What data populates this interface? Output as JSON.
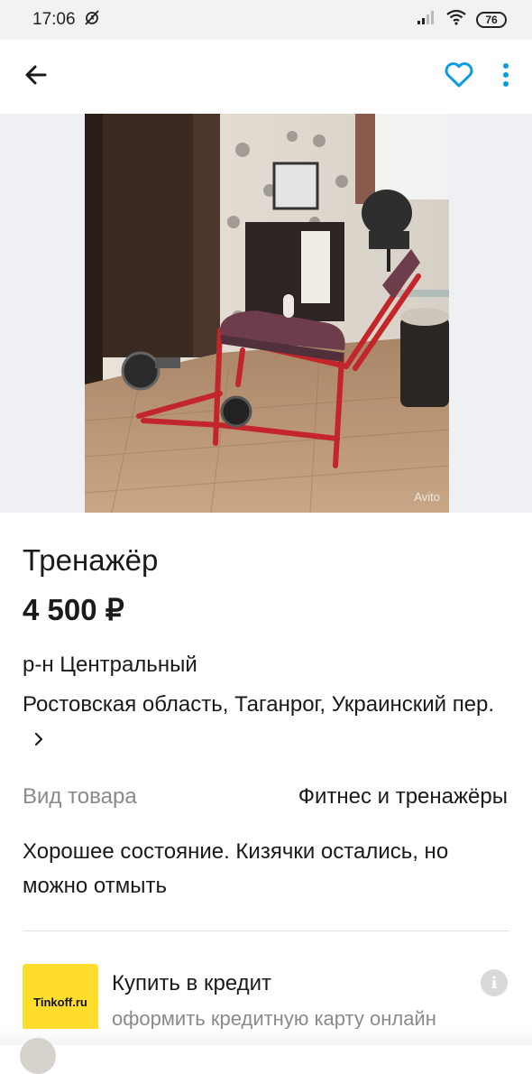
{
  "status_bar": {
    "time": "17:06",
    "battery": "76",
    "icons": [
      "muted-alarm-icon",
      "signal-icon",
      "wifi-icon",
      "battery-icon"
    ]
  },
  "app_bar": {
    "icons": [
      "back-arrow-icon",
      "heart-icon",
      "more-vert-icon"
    ],
    "accent_color": "#0a9ce0"
  },
  "photo": {
    "watermark": "Avito"
  },
  "listing": {
    "title": "Тренажёр",
    "price": "4 500 ₽",
    "district": "р-н Центральный",
    "address": "Ростовская область, Таганрог, Украинский пер.",
    "param_label": "Вид товара",
    "param_value": "Фитнес и тренажёры",
    "description": "Хорошее состояние. Кизячки остались, но можно отмыть"
  },
  "credit": {
    "logo_text": "Tinkoff.ru",
    "title": "Купить в кредит",
    "subtitle": "оформить кредитную карту онлайн",
    "logo_color": "#ffdd2d"
  }
}
